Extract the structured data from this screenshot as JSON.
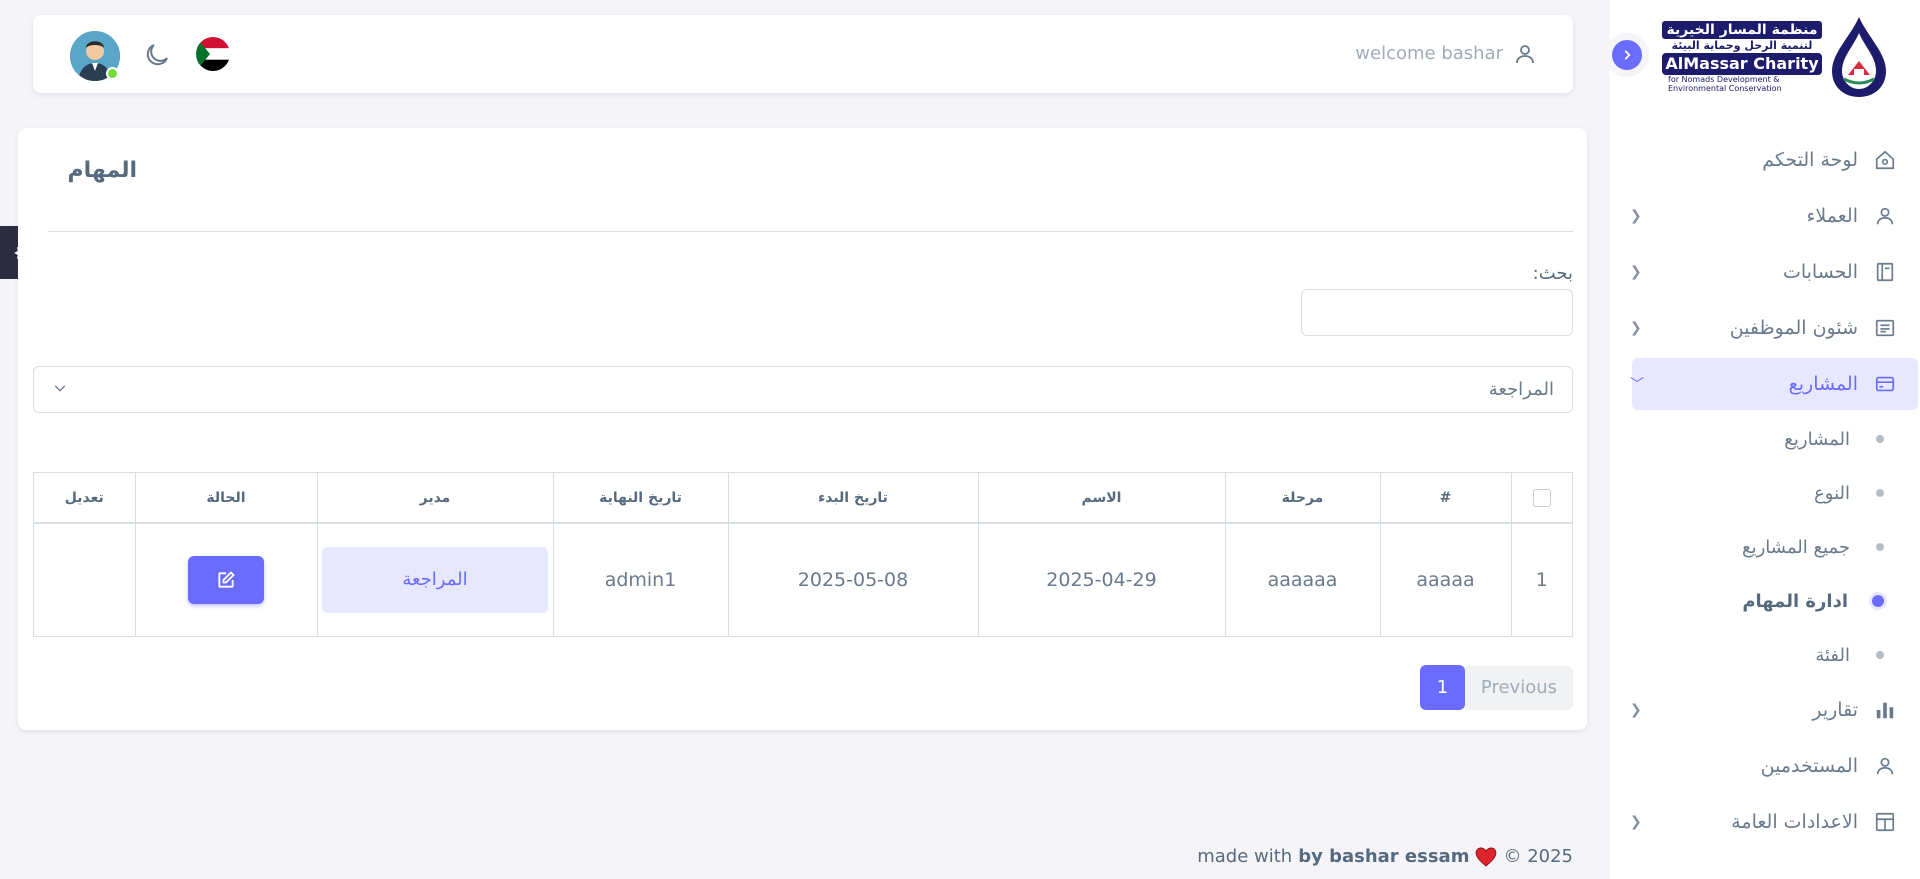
{
  "brand": {
    "ar_line1": "منظمة المسار الخيرية",
    "ar_line2": "لتنمية الرحل وحماية البيئة",
    "en_line1": "AlMassar Charity",
    "en_line2": "for Nomads Development &",
    "en_line3": "Environmental Conservation"
  },
  "sidebar": {
    "items": [
      {
        "label": "لوحة التحكم",
        "icon": "home-icon",
        "has_children": false
      },
      {
        "label": "العملاء",
        "icon": "user-icon",
        "has_children": true
      },
      {
        "label": "الحسابات",
        "icon": "ledger-icon",
        "has_children": true
      },
      {
        "label": "شئون الموظفين",
        "icon": "document-icon",
        "has_children": true
      },
      {
        "label": "المشاريع",
        "icon": "credit-card-icon",
        "has_children": true,
        "expanded": true
      },
      {
        "label": "تقارير",
        "icon": "bar-chart-icon",
        "has_children": true
      },
      {
        "label": "المستخدمين",
        "icon": "user-icon",
        "has_children": false
      },
      {
        "label": "الاعدادات العامة",
        "icon": "layout-icon",
        "has_children": true
      }
    ],
    "projects_sub": [
      {
        "label": "المشاريع"
      },
      {
        "label": "النوع"
      },
      {
        "label": "جميع المشاريع"
      },
      {
        "label": "ادارة المهام",
        "current": true
      },
      {
        "label": "الفئة"
      }
    ]
  },
  "navbar": {
    "welcome": "welcome bashar"
  },
  "page": {
    "title": "المهام",
    "search_label": "بحث:",
    "search_value": "",
    "status_filter": "المراجعة"
  },
  "table": {
    "headers": [
      "#",
      "مرحلة",
      "الاسم",
      "تاريخ البدء",
      "تاريخ النهاية",
      "مدير",
      "الحالة",
      "تعديل"
    ],
    "rows": [
      {
        "index": "1",
        "number": "aaaaa",
        "stage": "aaaaaa",
        "name": "2025-04-29",
        "start_date": "2025-05-08",
        "end_date": "admin1",
        "manager_status": "المراجعة"
      }
    ]
  },
  "pagination": {
    "previous": "Previous",
    "current_page": "1"
  },
  "footer": {
    "copyright": "© 2025",
    "made_with": "made with",
    "by": "by bashar essam"
  },
  "colors": {
    "primary": "#696cff",
    "primary_light": "#e7e7ff",
    "background": "#f5f5f9",
    "brand_navy": "#1d1b6b"
  }
}
